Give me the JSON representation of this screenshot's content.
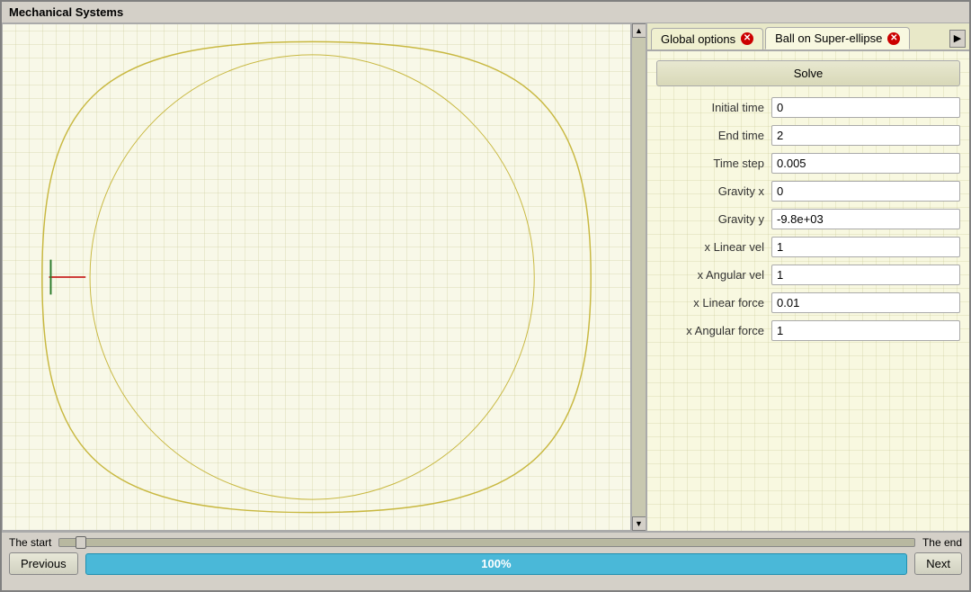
{
  "window": {
    "title": "Mechanical Systems"
  },
  "tabs": [
    {
      "id": "global-options",
      "label": "Global options",
      "closable": true,
      "active": false
    },
    {
      "id": "ball-on-superellipse",
      "label": "Ball on Super-ellipse",
      "closable": true,
      "active": true
    }
  ],
  "tab_scroll_btn": "▶",
  "panel": {
    "solve_label": "Solve",
    "fields": [
      {
        "id": "initial-time",
        "label": "Initial time",
        "value": "0"
      },
      {
        "id": "end-time",
        "label": "End time",
        "value": "2"
      },
      {
        "id": "time-step",
        "label": "Time step",
        "value": "0.005"
      },
      {
        "id": "gravity-x",
        "label": "Gravity x",
        "value": "0"
      },
      {
        "id": "gravity-y",
        "label": "Gravity y",
        "value": "-9.8e+03"
      },
      {
        "id": "x-linear-vel",
        "label": "x Linear vel",
        "value": "1"
      },
      {
        "id": "x-angular-vel",
        "label": "x Angular vel",
        "value": "1"
      },
      {
        "id": "x-linear-force",
        "label": "x Linear force",
        "value": "0.01"
      },
      {
        "id": "x-angular-force",
        "label": "x Angular force",
        "value": "1"
      }
    ]
  },
  "bottom": {
    "start_label": "The start",
    "end_label": "The end",
    "prev_label": "Previous",
    "next_label": "Next",
    "progress_label": "100%"
  }
}
